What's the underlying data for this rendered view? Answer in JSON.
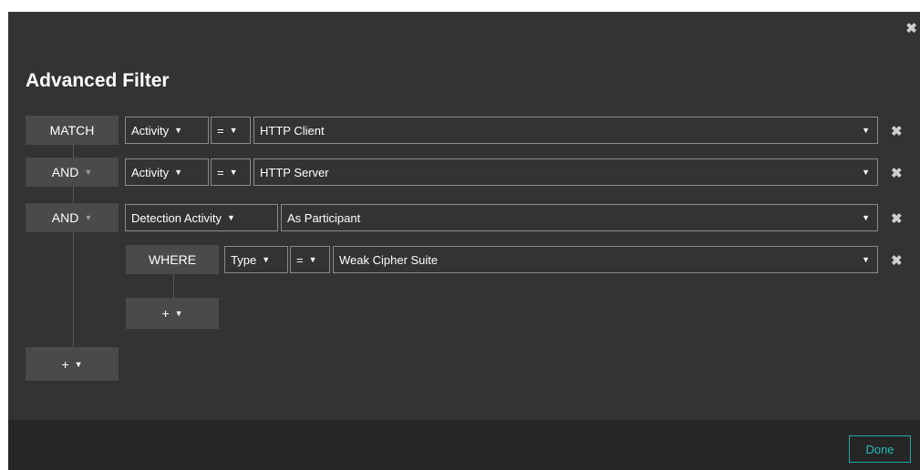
{
  "dialog": {
    "title": "Advanced Filter",
    "close_icon": "close-icon",
    "done_label": "Done"
  },
  "rows": [
    {
      "logic": "MATCH",
      "field": "Activity",
      "op": "=",
      "value": "HTTP Client"
    },
    {
      "logic": "AND",
      "field": "Activity",
      "op": "=",
      "value": "HTTP Server"
    },
    {
      "logic": "AND",
      "field": "Detection Activity",
      "value": "As Participant"
    }
  ],
  "where_row": {
    "logic": "WHERE",
    "field": "Type",
    "op": "=",
    "value": "Weak Cipher Suite"
  },
  "add": {
    "label": "+"
  },
  "icons": {
    "caret": "caret-down-icon",
    "remove": "remove-icon"
  },
  "colors": {
    "background": "#333333",
    "footer": "#262626",
    "accent": "#24b9b9"
  }
}
